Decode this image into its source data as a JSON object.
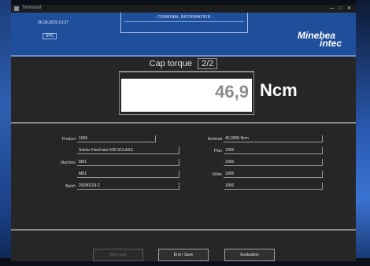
{
  "window": {
    "title": "Terminal",
    "controls": [
      "—",
      "□",
      "✕"
    ]
  },
  "header": {
    "datetime": "06.09.2019 13:27",
    "status": "SPC",
    "panel_title": "- TERMINAL INFORMATION -",
    "brand_line1": "Minebea",
    "brand_line2": "intec",
    "accent_color": "#1f4e9a"
  },
  "measurement": {
    "title": "Cap torque",
    "page": "2/2",
    "value": "46,9",
    "unit": "Ncm"
  },
  "fields": {
    "product_label": "Product",
    "product_code": "1006",
    "product_name": "Soluto Fixed tare 500 SCLASS",
    "machine_label": "Machine",
    "machine_1": "M01",
    "machine_2": "M01",
    "batch_label": "Batch",
    "batch_value": "20180129-2",
    "nominal_label": "Nominal",
    "nominal_value": "45,0000 Ncm",
    "plan_label": "Plan",
    "plan_1": "1006",
    "plan_2": "1006",
    "order_label": "Order",
    "order_1": "1006",
    "order_2": "1006"
  },
  "buttons": {
    "new_save": "New save",
    "end_save": "End / Save",
    "evaluation": "Evaluation"
  }
}
